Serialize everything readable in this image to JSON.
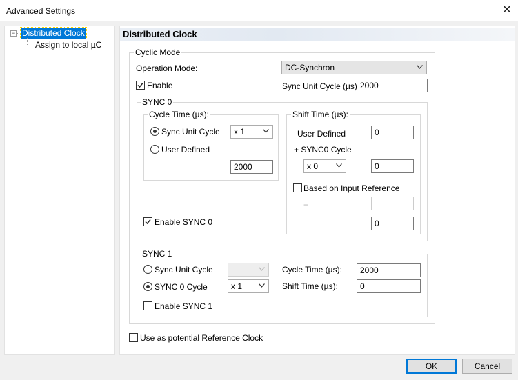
{
  "window": {
    "title": "Advanced Settings",
    "close_glyph": "✕"
  },
  "tree": {
    "expander": "−",
    "items": [
      {
        "label": "Distributed Clock"
      },
      {
        "label": "Assign to local µC"
      }
    ]
  },
  "panel": {
    "title": "Distributed Clock"
  },
  "cyclic_mode": {
    "legend": "Cyclic Mode",
    "operation_mode_label": "Operation Mode:",
    "operation_mode_value": "DC-Synchron",
    "enable_label": "Enable",
    "enable_checked": true,
    "sync_unit_cycle_label": "Sync Unit Cycle (µs):",
    "sync_unit_cycle_value": "2000"
  },
  "sync0": {
    "legend": "SYNC 0",
    "cycle_time": {
      "legend": "Cycle Time (µs):",
      "sync_unit_cycle_label": "Sync Unit Cycle",
      "sync_unit_cycle_selected": true,
      "multiplier_value": "x 1",
      "user_defined_label": "User Defined",
      "user_defined_selected": false,
      "value": "2000"
    },
    "shift_time": {
      "legend": "Shift Time (µs):",
      "user_defined_label": "User Defined",
      "user_defined_value": "0",
      "sync0_cycle_label": "+ SYNC0 Cycle",
      "multiplier_value": "x 0",
      "sync0_cycle_value": "0",
      "based_on_input_label": "Based on Input Reference",
      "based_on_input_checked": false,
      "plus_sign": "+",
      "input_ref_value": "",
      "equals_sign": "=",
      "result_value": "0"
    },
    "enable_label": "Enable SYNC 0",
    "enable_checked": true
  },
  "sync1": {
    "legend": "SYNC 1",
    "sync_unit_cycle_label": "Sync Unit Cycle",
    "sync_unit_cycle_selected": false,
    "sync0_cycle_label": "SYNC 0 Cycle",
    "sync0_cycle_selected": true,
    "multiplier_value": "x 1",
    "cycle_time_label": "Cycle Time (µs):",
    "cycle_time_value": "2000",
    "shift_time_label": "Shift Time (µs):",
    "shift_time_value": "0",
    "enable_label": "Enable SYNC 1",
    "enable_checked": false
  },
  "reference_clock": {
    "label": "Use as potential Reference Clock",
    "checked": false
  },
  "buttons": {
    "ok": "OK",
    "cancel": "Cancel"
  }
}
